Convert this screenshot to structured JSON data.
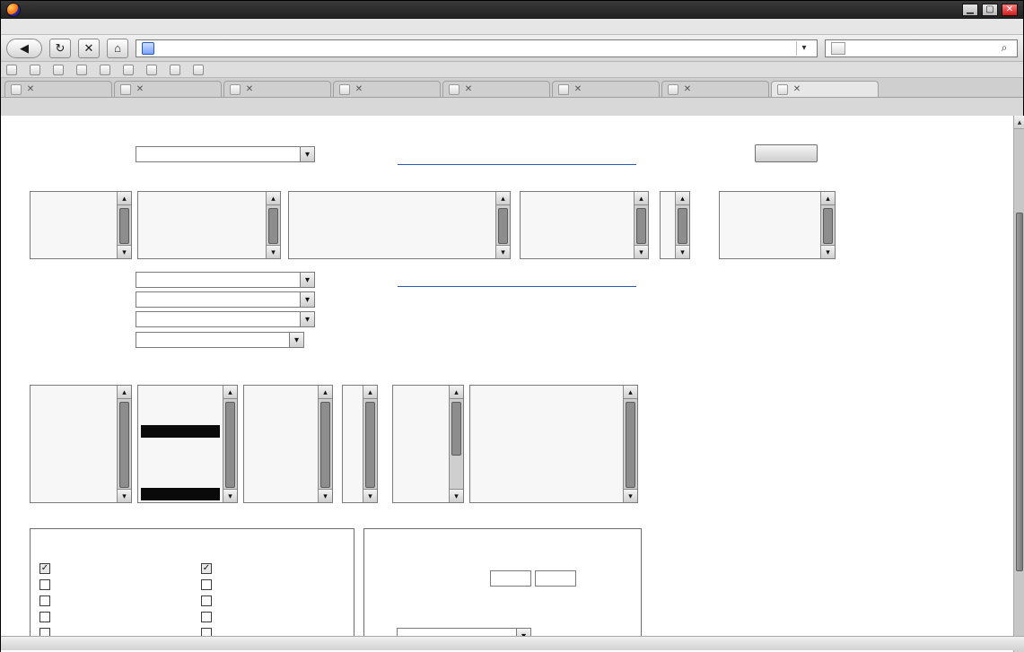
{
  "window": {
    "title": "",
    "menu": [
      "",
      "",
      "",
      "",
      "",
      "",
      "",
      ""
    ],
    "controls": {
      "minimize": "▁",
      "maximize": "▢",
      "close": "✕"
    }
  },
  "nav": {
    "back": "◀",
    "forward": "▶",
    "reload": "↻",
    "stop": "✕",
    "home": "⌂",
    "url": "",
    "url_dropdown": "▾",
    "search_placeholder": "",
    "search_value": "",
    "search_go": "⌕"
  },
  "bookmarks": [
    "",
    "",
    "",
    "",
    "",
    "",
    "",
    "",
    ""
  ],
  "tabs": [
    {
      "label": "",
      "active": false
    },
    {
      "label": "",
      "active": false
    },
    {
      "label": "",
      "active": false
    },
    {
      "label": "",
      "active": false
    },
    {
      "label": "",
      "active": false
    },
    {
      "label": "",
      "active": false
    },
    {
      "label": "",
      "active": false
    },
    {
      "label": "",
      "active": true
    }
  ],
  "page": {
    "top": {
      "summary_label": "",
      "summary_value": "",
      "search_button": ""
    },
    "row1": {
      "headers": [
        "",
        "",
        "",
        "",
        "",
        ""
      ],
      "lists": {
        "class_families": [
          "",
          "",
          "",
          "",
          ""
        ],
        "products": [
          "",
          "",
          "",
          "",
          "",
          ""
        ],
        "components": [
          "",
          "",
          "",
          "",
          ""
        ],
        "versions": [
          "",
          "",
          "",
          "",
          ""
        ],
        "fixed_in": [
          "",
          "",
          "",
          "",
          ""
        ],
        "target": [
          "",
          "",
          "",
          "",
          ""
        ]
      }
    },
    "row2": {
      "fields": [
        {
          "label": "",
          "value": ""
        },
        {
          "label": "",
          "value": ""
        },
        {
          "label": "",
          "value": ""
        },
        {
          "label": "",
          "value": ""
        }
      ]
    },
    "row3": {
      "headers": [
        "",
        "",
        "",
        "",
        "",
        ""
      ],
      "lists": {
        "status": [
          "",
          "",
          "",
          "",
          "",
          "",
          "",
          ""
        ],
        "resolution": [
          "",
          "",
          "",
          "",
          "",
          "",
          "",
          "",
          ""
        ],
        "severity": [
          "",
          "",
          "",
          "",
          "",
          "",
          ""
        ],
        "priority": [
          "",
          "",
          "",
          "",
          "",
          "",
          ""
        ],
        "hardware": [
          "",
          "",
          "",
          "",
          "",
          "",
          "",
          "",
          ""
        ],
        "os": [
          "",
          "",
          "",
          "",
          "",
          "",
          "",
          "",
          ""
        ]
      }
    },
    "groups": {
      "left_title": "",
      "left_subtitle": "",
      "left_checks": [
        {
          "label": "",
          "checked": true
        },
        {
          "label": "",
          "checked": false
        },
        {
          "label": "",
          "checked": false
        },
        {
          "label": "",
          "checked": false
        },
        {
          "label": "",
          "checked": false
        },
        {
          "label": "",
          "checked": true
        },
        {
          "label": "",
          "checked": false
        },
        {
          "label": "",
          "checked": false
        },
        {
          "label": "",
          "checked": false
        },
        {
          "label": "",
          "checked": false
        }
      ],
      "right_title": "",
      "right_text1": "",
      "right_text2": "",
      "right_text3": "",
      "right_small_input_left": "",
      "right_small_input_right": "",
      "right_select": ""
    }
  },
  "status": {
    "left": "",
    "right": ""
  }
}
